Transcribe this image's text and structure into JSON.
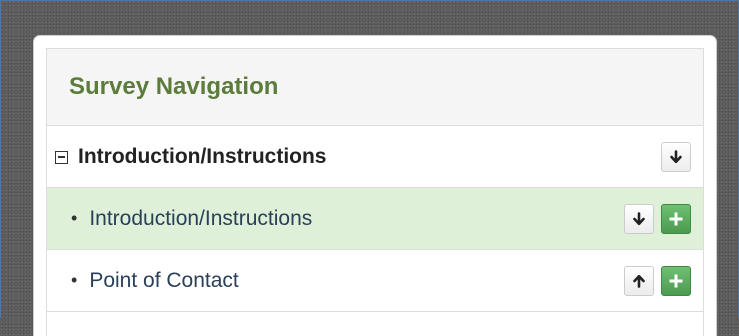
{
  "panel": {
    "title": "Survey Navigation"
  },
  "section": {
    "label": "Introduction/Instructions",
    "toggle_icon": "collapse-minus-icon",
    "buttons": [
      "move-down"
    ]
  },
  "items": [
    {
      "bullet": "•",
      "label": "Introduction/Instructions",
      "active": true,
      "buttons": [
        "move-down",
        "add"
      ]
    },
    {
      "bullet": "•",
      "label": "Point of Contact",
      "active": false,
      "buttons": [
        "move-up",
        "add"
      ]
    }
  ],
  "colors": {
    "title": "#5b7c3a",
    "active_row": "#dff0d8",
    "add_button": "#5cb85c",
    "item_text": "#2a3f58"
  }
}
